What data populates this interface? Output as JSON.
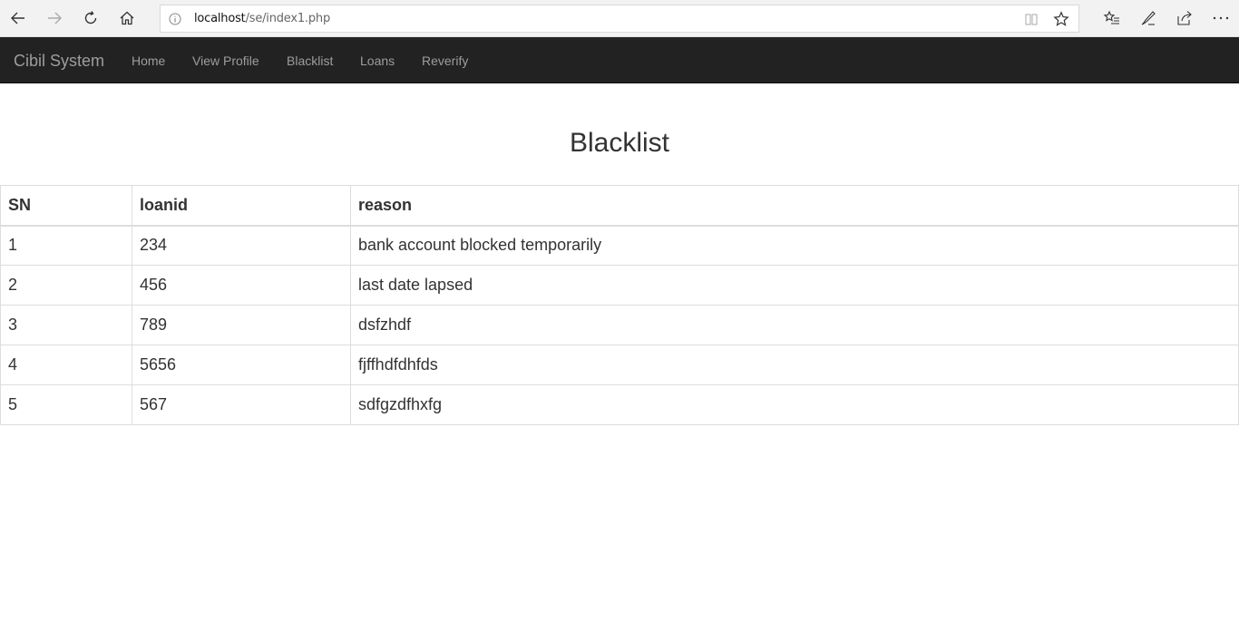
{
  "browser": {
    "url_host": "localhost",
    "url_path": "/se/index1.php"
  },
  "navbar": {
    "brand": "Cibil System",
    "links": [
      "Home",
      "View Profile",
      "Blacklist",
      "Loans",
      "Reverify"
    ]
  },
  "main": {
    "title": "Blacklist",
    "table": {
      "headers": [
        "SN",
        "loanid",
        "reason"
      ],
      "rows": [
        [
          "1",
          "234",
          "bank account blocked temporarily"
        ],
        [
          "2",
          "456",
          "last date lapsed"
        ],
        [
          "3",
          "789",
          "dsfzhdf"
        ],
        [
          "4",
          "5656",
          "fjffhdfdhfds"
        ],
        [
          "5",
          "567",
          "sdfgzdfhxfg"
        ]
      ]
    }
  },
  "colors": {
    "navbar_bg": "#222222",
    "navbar_text": "#9d9d9d",
    "table_border": "#dddddd"
  }
}
